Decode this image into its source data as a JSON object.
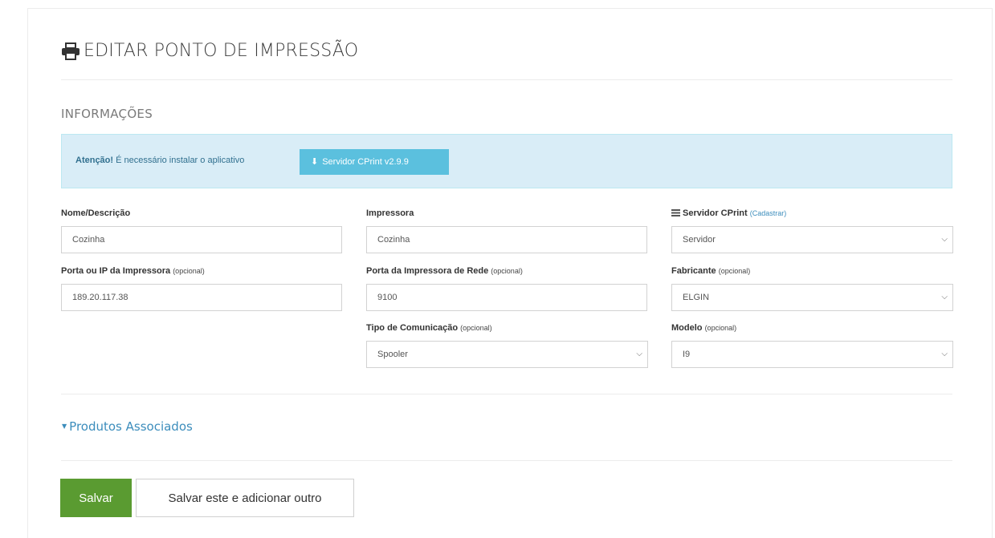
{
  "page": {
    "title": "EDITAR PONTO DE IMPRESSÃO",
    "title_icon": "printer-icon"
  },
  "section": {
    "title": "INFORMAÇÕES"
  },
  "alert": {
    "strong": "Atenção!",
    "text": " É necessário instalar o aplicativo",
    "button_label": "Servidor CPrint v2.9.9",
    "button_icon": "download-icon"
  },
  "form": {
    "nome": {
      "label": "Nome/Descrição",
      "value": "Cozinha"
    },
    "impressora": {
      "label": "Impressora",
      "value": "Cozinha"
    },
    "servidor": {
      "label": "Servidor CPrint",
      "link": "(Cadastrar)",
      "value": "Servidor",
      "icon": "list-icon"
    },
    "porta_ip": {
      "label": "Porta ou IP da Impressora",
      "optional": "(opcional)",
      "value": "189.20.117.38"
    },
    "porta_rede": {
      "label": "Porta da Impressora de Rede",
      "optional": "(opcional)",
      "value": "9100"
    },
    "fabricante": {
      "label": "Fabricante",
      "optional": "(opcional)",
      "value": "ELGIN"
    },
    "tipo_com": {
      "label": "Tipo de Comunicação",
      "optional": "(opcional)",
      "value": "Spooler"
    },
    "modelo": {
      "label": "Modelo",
      "optional": "(opcional)",
      "value": "I9"
    }
  },
  "associated": {
    "label": "Produtos Associados",
    "icon": "caret-down-icon"
  },
  "buttons": {
    "save": "Salvar",
    "save_add": "Salvar este e adicionar outro"
  },
  "colors": {
    "alert_bg": "#d9edf7",
    "info_button": "#5bc0de",
    "save_button": "#5a9b31",
    "link": "#3c8dbc"
  }
}
